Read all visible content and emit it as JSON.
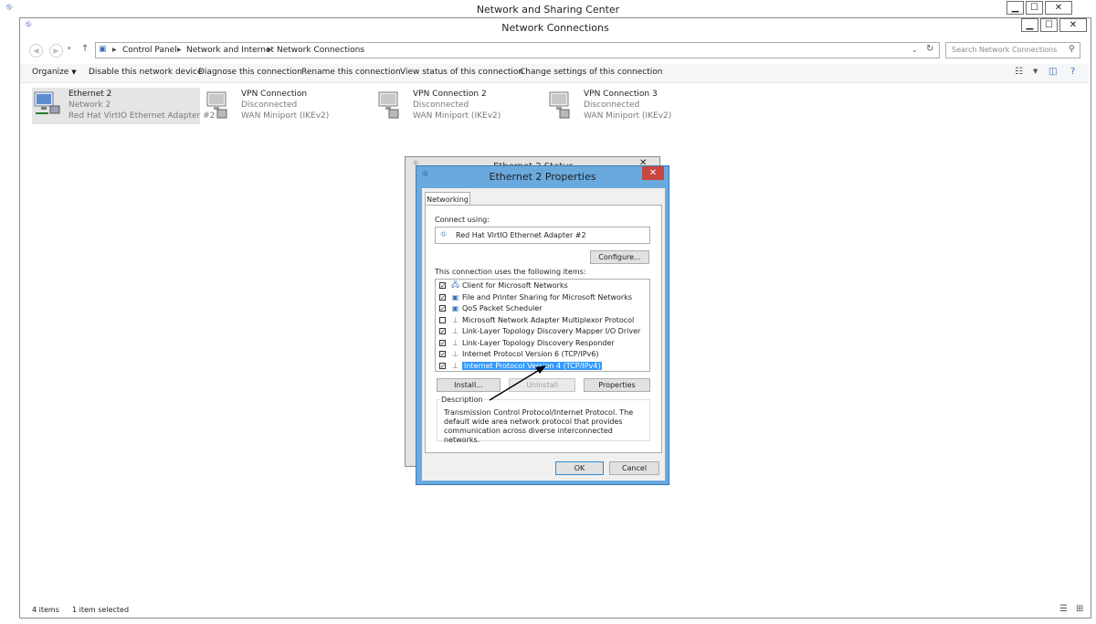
{
  "outer_window": {
    "title": "Network and Sharing Center",
    "minimize": "▁",
    "maximize": "☐",
    "close": "✕"
  },
  "window": {
    "title": "Network Connections",
    "minimize": "▁",
    "maximize": "☐",
    "close": "✕"
  },
  "address_bar": {
    "path": [
      "Control Panel",
      "Network and Internet",
      "Network Connections"
    ],
    "search_placeholder": "Search Network Connections"
  },
  "toolbar": {
    "items": [
      "Organize",
      "Disable this network device",
      "Diagnose this connection",
      "Rename this connection",
      "View status of this connection",
      "Change settings of this connection"
    ]
  },
  "connections": [
    {
      "name": "Ethernet 2",
      "status": "Network 2",
      "adapter": "Red Hat VirtIO Ethernet Adapter #2",
      "selected": true
    },
    {
      "name": "VPN Connection",
      "status": "Disconnected",
      "adapter": "WAN Miniport (IKEv2)"
    },
    {
      "name": "VPN Connection 2",
      "status": "Disconnected",
      "adapter": "WAN Miniport (IKEv2)"
    },
    {
      "name": "VPN Connection 3",
      "status": "Disconnected",
      "adapter": "WAN Miniport (IKEv2)"
    }
  ],
  "status_bar": {
    "item_count": "4 items",
    "selected_count": "1 item selected"
  },
  "status_dialog": {
    "title": "Ethernet 2 Status",
    "close": "✕"
  },
  "properties_dialog": {
    "title": "Ethernet 2 Properties",
    "close": "✕",
    "tab": "Networking",
    "connect_using_label": "Connect using:",
    "adapter_name": "Red Hat VirtIO Ethernet Adapter #2",
    "configure_button": "Configure...",
    "items_label": "This connection uses the following items:",
    "items": [
      {
        "label": "Client for Microsoft Networks",
        "checked": true
      },
      {
        "label": "File and Printer Sharing for Microsoft Networks",
        "checked": true
      },
      {
        "label": "QoS Packet Scheduler",
        "checked": true
      },
      {
        "label": "Microsoft Network Adapter Multiplexor Protocol",
        "checked": false
      },
      {
        "label": "Link-Layer Topology Discovery Mapper I/O Driver",
        "checked": true
      },
      {
        "label": "Link-Layer Topology Discovery Responder",
        "checked": true
      },
      {
        "label": "Internet Protocol Version 6 (TCP/IPv6)",
        "checked": true
      },
      {
        "label": "Internet Protocol Version 4 (TCP/IPv4)",
        "checked": true,
        "selected": true
      }
    ],
    "install_button": "Install...",
    "uninstall_button": "Uninstall",
    "properties_button": "Properties",
    "description_label": "Description",
    "description_text": "Transmission Control Protocol/Internet Protocol. The default wide area network protocol that provides communication across diverse interconnected networks.",
    "ok_button": "OK",
    "cancel_button": "Cancel"
  },
  "colors": {
    "dialog_frame": "#6aa9de",
    "close_button": "#c7473e",
    "selection": "#3399ff"
  }
}
